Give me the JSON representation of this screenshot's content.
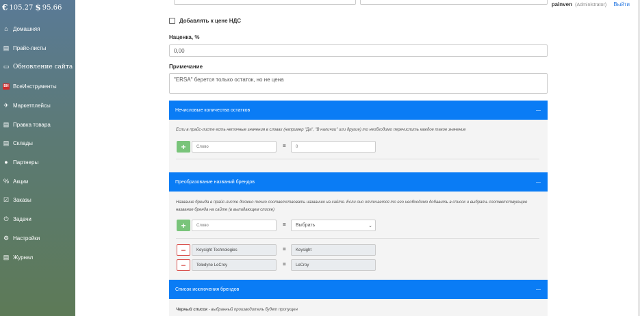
{
  "sidebar": {
    "currency": {
      "euro_symbol": "€",
      "euro_value": "105.27",
      "usd_symbol": "$",
      "usd_value": "95.66"
    },
    "items": [
      {
        "label": "Домашняя",
        "icon": "home-icon",
        "glyph": "⌂"
      },
      {
        "label": "Прайс-листы",
        "icon": "list-icon",
        "glyph": "▤"
      },
      {
        "label": "Обновление сайта",
        "icon": "window-icon",
        "glyph": "▭"
      },
      {
        "label": "ВсеИнструменты",
        "icon": "vseinstrumenty-logo-icon",
        "glyph": "ВИ"
      },
      {
        "label": "Маркетплейсы",
        "icon": "marketplace-icon",
        "glyph": "✈"
      },
      {
        "label": "Правка товара",
        "icon": "grid-icon",
        "glyph": "▤"
      },
      {
        "label": "Склады",
        "icon": "warehouse-icon",
        "glyph": "▤"
      },
      {
        "label": "Партнеры",
        "icon": "user-icon",
        "glyph": "●"
      },
      {
        "label": "Акции",
        "icon": "percent-icon",
        "glyph": "%"
      },
      {
        "label": "Заказы",
        "icon": "checkbox-icon",
        "glyph": "☑"
      },
      {
        "label": "Задачи",
        "icon": "power-icon",
        "glyph": "⏻"
      },
      {
        "label": "Настройки",
        "icon": "gear-icon",
        "glyph": "⚙"
      },
      {
        "label": "Журнал",
        "icon": "book-icon",
        "glyph": "▤"
      }
    ]
  },
  "header": {
    "username": "painven",
    "role": "(Administrator)",
    "logout": "Выйти"
  },
  "form": {
    "vat_label": "Добавлять к цене НДС",
    "markup_label": "Наценка, %",
    "markup_value": "0,00",
    "note_label": "Примечание",
    "note_value": "\"ERSA\" берется только остаток, но не цена"
  },
  "panels": {
    "nonnumeric": {
      "title": "Нечисловые количества остатков",
      "collapse": "—",
      "desc": "Если в прайс-листе есть неточные значения в словах (например \"Да\", \"В наличии\" или другие) то необходимо перечислить каждое такое значение",
      "word_placeholder": "Слово",
      "eq": "=",
      "value": "0"
    },
    "brands": {
      "title": "Преобразование названий брендов",
      "collapse": "—",
      "desc": "Название бренда в прайс-листе должно точно соответствовать названию на сайте. Если оно отличается то его необходимо добавить в список и выбрать соответствующее название бренда на сайте (в выпадающем списке)",
      "word_placeholder": "Слово",
      "eq": "=",
      "select_value": "Выбрать",
      "rows": [
        {
          "from": "Keysight Technologies",
          "to": "Keysight"
        },
        {
          "from": "Teledyne LeCroy",
          "to": "LeCroy"
        }
      ]
    },
    "exclusions": {
      "title": "Список исключения брендов",
      "collapse": "—",
      "blacklist_bold": "Черный список",
      "blacklist_rest": " - выбранный производитель будет пропущен"
    }
  }
}
